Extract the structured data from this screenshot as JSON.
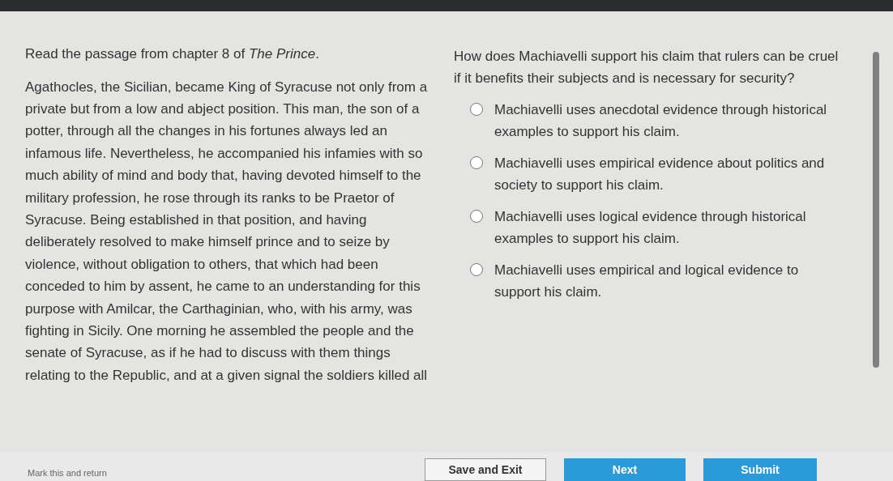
{
  "passage": {
    "intro": "Read the passage from chapter 8 of *The Prince*.",
    "text": "Agathocles, the Sicilian, became King of Syracuse not only from a private but from a low and abject position. This man, the son of a potter, through all the changes in his fortunes always led an infamous life. Nevertheless, he accompanied his infamies with so much ability of mind and body that, having devoted himself to the military profession, he rose through its ranks to be Praetor of Syracuse. Being established in that position, and having deliberately resolved to make himself prince and to seize by violence, without obligation to others, that which had been conceded to him by assent, he came to an understanding for this purpose with Amilcar, the Carthaginian, who, with his army, was fighting in Sicily. One morning he assembled the people and the senate of Syracuse, as if he had to discuss with them things relating to the Republic, and at a given signal the soldiers killed all"
  },
  "question": "How does Machiavelli support his claim that rulers can be cruel if it benefits their subjects and is necessary for security?",
  "options": [
    {
      "text": "Machiavelli uses anecdotal evidence through historical examples to support his claim.",
      "selected": false
    },
    {
      "text": "Machiavelli uses empirical evidence about politics and society to support his claim.",
      "selected": false
    },
    {
      "text": "Machiavelli uses logical evidence through historical examples to support his claim.",
      "selected": false
    },
    {
      "text": "Machiavelli uses empirical and logical evidence to support his claim.",
      "selected": false
    }
  ],
  "footer": {
    "mark_link": "Mark this and return",
    "buttons": [
      {
        "label": "Save and Exit",
        "kind": "secondary"
      },
      {
        "label": "Next",
        "kind": "next"
      },
      {
        "label": "Submit",
        "kind": "primary"
      }
    ]
  }
}
